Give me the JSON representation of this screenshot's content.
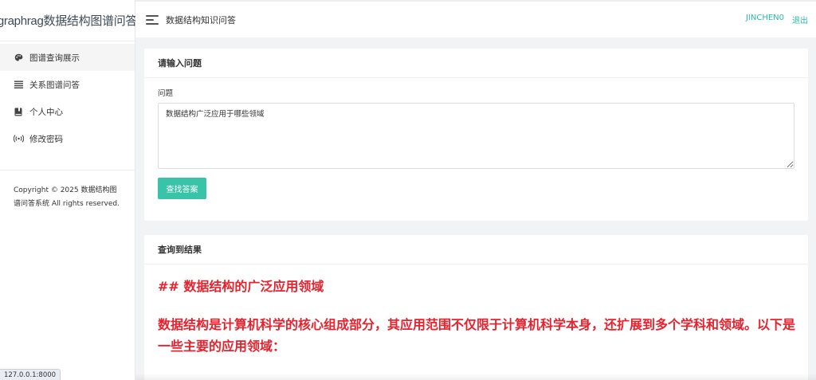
{
  "brand": {
    "title": "graphrag数据结构图谱问答"
  },
  "sidebar": {
    "items": [
      {
        "label": "图谱查询展示",
        "icon": "palette-icon"
      },
      {
        "label": "关系图谱问答",
        "icon": "list-icon"
      },
      {
        "label": "个人中心",
        "icon": "book-icon"
      },
      {
        "label": "修改密码",
        "icon": "broadcast-icon"
      }
    ],
    "copyright": "Copyright © 2025 数据结构图谱问答系统 All rights reserved."
  },
  "topbar": {
    "title": "数据结构知识问答",
    "user": "JINCHEN0",
    "logout": "退出"
  },
  "query_card": {
    "header": "请输入问题",
    "field_label": "问题",
    "question_value": "数据结构广泛应用于哪些领域",
    "button_label": "查找答案"
  },
  "result_card": {
    "header": "查询到结果",
    "heading": "## 数据结构的广泛应用领域",
    "paragraph": "数据结构是计算机科学的核心组成部分，其应用范围不仅限于计算机科学本身，还扩展到多个学科和领域。以下是一些主要的应用领域："
  },
  "status_bar": {
    "url": "127.0.0.1:8000"
  },
  "colors": {
    "accent": "#39c3a9",
    "link": "#2bbaa6",
    "result_text": "#e8212d"
  }
}
